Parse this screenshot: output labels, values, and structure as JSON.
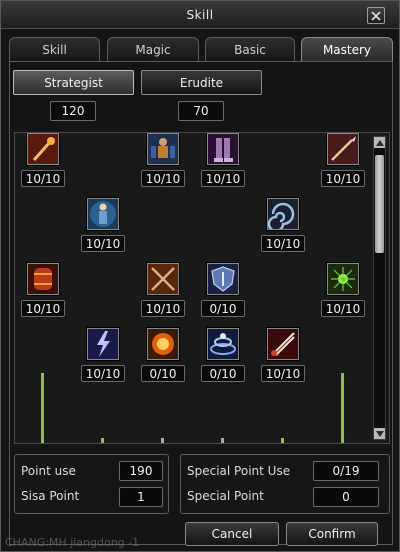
{
  "window": {
    "title": "Skill"
  },
  "tabs": [
    {
      "label": "Skill"
    },
    {
      "label": "Magic"
    },
    {
      "label": "Basic"
    },
    {
      "label": "Mastery"
    }
  ],
  "specializations": [
    {
      "label": "Strategist",
      "points": "120",
      "active": true
    },
    {
      "label": "Erudite",
      "points": "70",
      "active": false
    }
  ],
  "skills": [
    {
      "level": "10/10",
      "icon": "torch-staff-icon",
      "color": "#b24020"
    },
    {
      "level": "10/10",
      "icon": "warrior-figure-icon",
      "color": "#30507a"
    },
    {
      "level": "10/10",
      "icon": "armored-legs-icon",
      "color": "#5a2a6a"
    },
    {
      "level": "10/10",
      "icon": "spear-icon",
      "color": "#7a2a2a"
    },
    {
      "level": "10/10",
      "icon": "aura-figure-icon",
      "color": "#2f6ea0"
    },
    {
      "level": "10/10",
      "icon": "vortex-icon",
      "color": "#4a5a7a"
    },
    {
      "level": "10/10",
      "icon": "barrel-icon",
      "color": "#9a3018"
    },
    {
      "level": "10/10",
      "icon": "crossed-swords-icon",
      "color": "#7a3a1a"
    },
    {
      "level": "0/10",
      "icon": "shield-icon",
      "color": "#2a3a6a"
    },
    {
      "level": "10/10",
      "icon": "sparkle-icon",
      "color": "#2a4a1a"
    },
    {
      "level": "10/10",
      "icon": "lightning-icon",
      "color": "#3a3a9a"
    },
    {
      "level": "0/10",
      "icon": "flame-orb-icon",
      "color": "#a04010"
    },
    {
      "level": "0/10",
      "icon": "whirlwind-icon",
      "color": "#2a4a8a"
    },
    {
      "level": "10/10",
      "icon": "blades-icon",
      "color": "#8a1a1a"
    }
  ],
  "points": {
    "point_use_label": "Point use",
    "point_use_value": "190",
    "sisa_label": "Sisa Point",
    "sisa_value": "1",
    "special_use_label": "Special Point Use",
    "special_use_value": "0/19",
    "special_label": "Special Point",
    "special_value": "0"
  },
  "buttons": {
    "cancel": "Cancel",
    "confirm": "Confirm"
  },
  "chat": {
    "line": "CHANG:MH jiangdong -1"
  },
  "colors": {
    "line_active": "#8bc34a",
    "line_inactive": "#a8a8a8"
  }
}
